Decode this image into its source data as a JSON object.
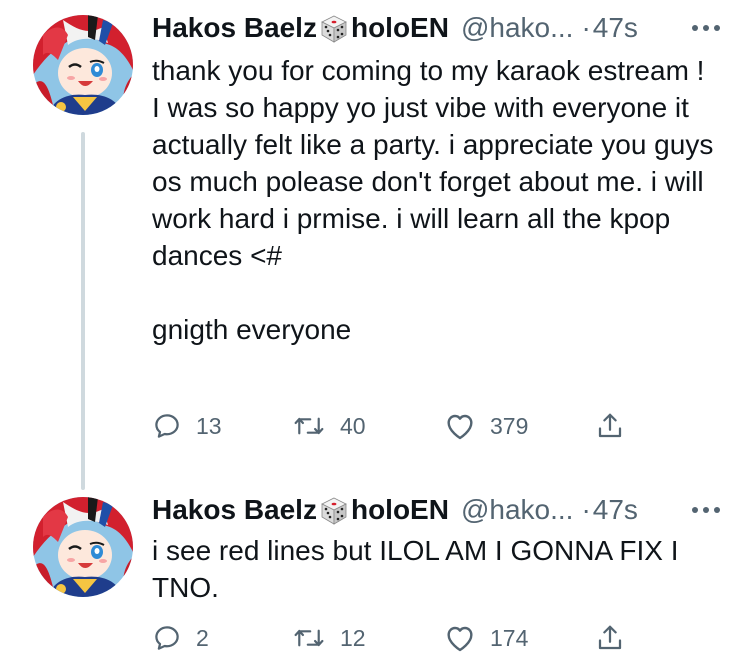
{
  "tweets": [
    {
      "name_part1": "Hakos Baelz",
      "name_part2": "holoEN",
      "handle": "@hako...",
      "separator": "·",
      "time": "47s",
      "lines": [
        "thank you for coming to my karaok estream !",
        "I was so happy yo just vibe with everyone it actually felt like a party. i appreciate you guys os much polease don't forget about me. i will work hard i prmise. i will learn all the kpop dances <#",
        "",
        "gnigth everyone"
      ],
      "replies": "13",
      "retweets": "40",
      "likes": "379"
    },
    {
      "name_part1": "Hakos Baelz",
      "name_part2": "holoEN",
      "handle": "@hako...",
      "separator": "·",
      "time": "47s",
      "lines": [
        "i see red lines but ILOL AM I GONNA FIX I TNO."
      ],
      "replies": "2",
      "retweets": "12",
      "likes": "174"
    }
  ],
  "icons": {
    "reply": "reply-icon",
    "retweet": "retweet-icon",
    "like": "heart-icon",
    "share": "share-icon",
    "more": "more-dots-icon",
    "dice": "dice-emoji-icon"
  },
  "colors": {
    "text_primary": "#0f1419",
    "text_secondary": "#536471",
    "thread_line": "#cfd9de"
  }
}
